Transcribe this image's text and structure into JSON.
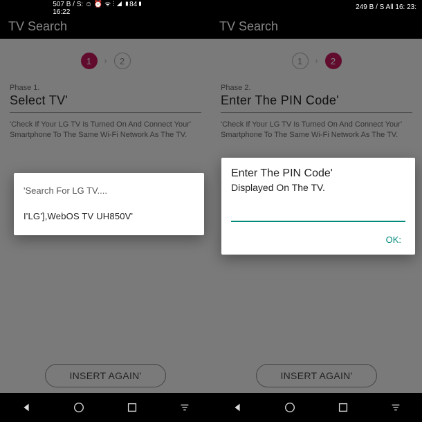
{
  "left": {
    "status": {
      "center": "507 B / S: ☺ ⏰ ᯤ ⫶ ◢ ▮84▮ 16:22",
      "right": ""
    },
    "appbar": {
      "title": "TV Search"
    },
    "stepper": {
      "step1": "1",
      "step2": "2"
    },
    "phase": {
      "label": "Phase 1.",
      "title": "Select TV'"
    },
    "help": "'Check If Your LG TV Is Turned On And Connect Your' Smartphone To The Same Wi-Fi Network As The TV.",
    "dialog": {
      "title": "'Search For LG TV....",
      "item": "I'LG'],WebOS TV UH850V'"
    },
    "insert": "INSERT AGAIN'"
  },
  "right": {
    "status": {
      "right": "249 B / S All 16: 23:"
    },
    "appbar": {
      "title": "TV Search"
    },
    "stepper": {
      "step1": "1",
      "step2": "2"
    },
    "phase": {
      "label": "Phase 2.",
      "title": "Enter The PIN Code'"
    },
    "help": "'Check If Your LG TV Is Turned On And Connect Your' Smartphone To The Same Wi-Fi Network As The TV.",
    "dialog": {
      "title": "Enter The PIN Code'",
      "sub": "Displayed On The TV.",
      "ok": "OK:"
    },
    "insert": "INSERT AGAIN'"
  }
}
